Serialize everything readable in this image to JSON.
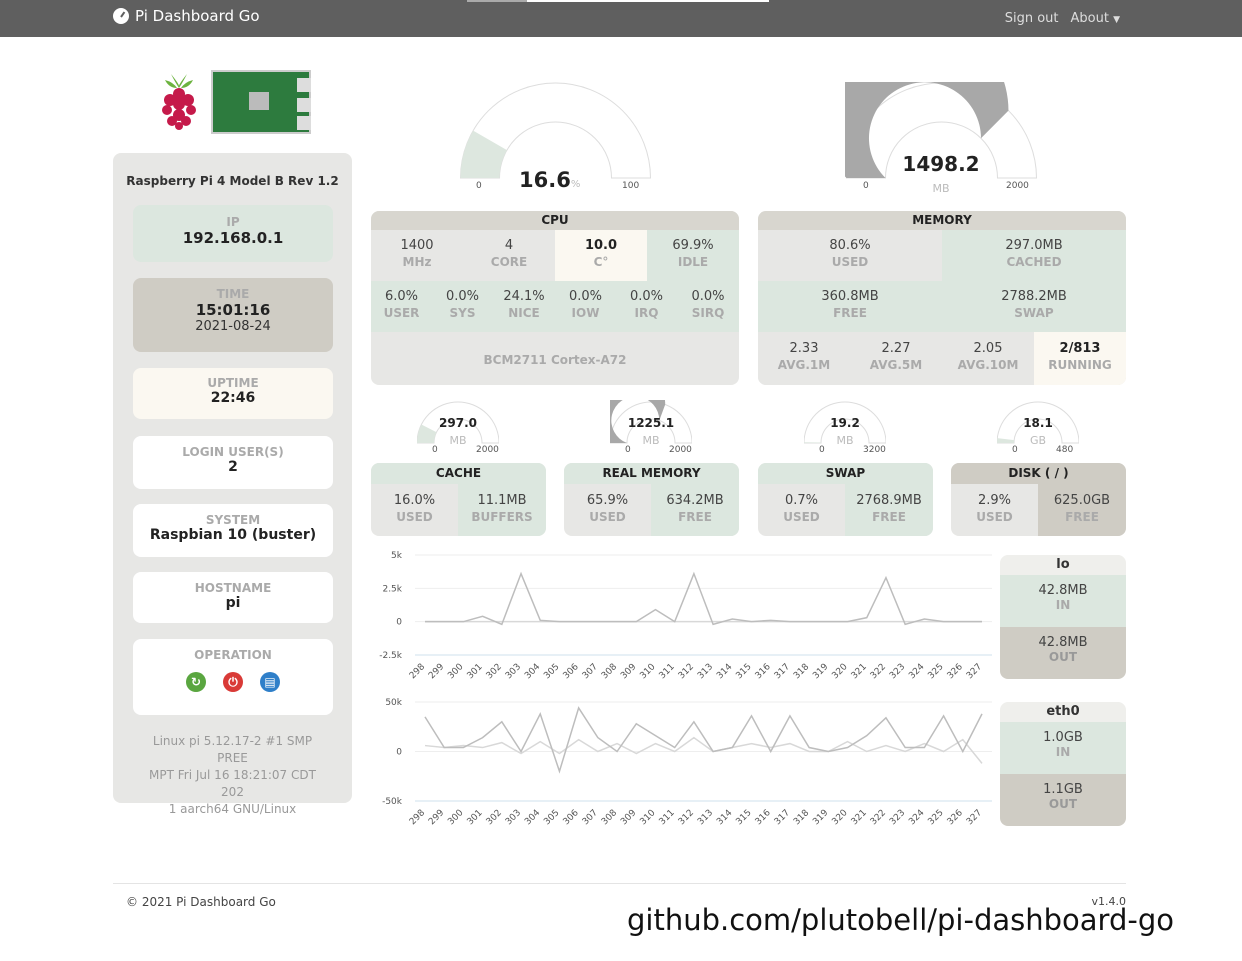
{
  "nav": {
    "brand": "Pi Dashboard Go",
    "sign_out": "Sign out",
    "about": "About"
  },
  "colors": {
    "green": "#dce7df",
    "tan": "#cfccc4",
    "cream": "#fbf8f1",
    "white": "#ffffff",
    "header": "#d8d6cf",
    "gray_panel": "#e7e7e5",
    "gauge_fill": "#a8a8a8",
    "gauge_green": "#dde7df"
  },
  "sidebar": {
    "model": "Raspberry Pi 4 Model B Rev 1.2",
    "ip": {
      "label": "IP",
      "value": "192.168.0.1"
    },
    "time": {
      "label": "TIME",
      "value": "15:01:16",
      "date": "2021-08-24"
    },
    "uptime": {
      "label": "UPTIME",
      "value": "22:46"
    },
    "login": {
      "label": "LOGIN USER(S)",
      "value": "2"
    },
    "system": {
      "label": "SYSTEM",
      "value": "Raspbian 10 (buster)"
    },
    "hostname": {
      "label": "HOSTNAME",
      "value": "pi"
    },
    "operation": {
      "label": "OPERATION",
      "icons": [
        "reboot-icon",
        "power-icon",
        "trash-icon"
      ]
    },
    "sysinfo": [
      "Linux pi 5.12.17-2 #1 SMP PREE",
      "MPT Fri Jul 16 18:21:07 CDT 202",
      "1 aarch64 GNU/Linux"
    ]
  },
  "cpu_gauge": {
    "value": "16.6",
    "unit": "%",
    "min": "0",
    "max": "100",
    "level": 0.166
  },
  "mem_gauge": {
    "value": "1498.2",
    "unit": "MB",
    "min": "0",
    "max": "2000",
    "level": 0.749
  },
  "cpu": {
    "title": "CPU",
    "row1": [
      {
        "v": "1400",
        "l": "MHz"
      },
      {
        "v": "4",
        "l": "CORE"
      },
      {
        "v": "10.0",
        "l": "C°"
      },
      {
        "v": "69.9%",
        "l": "IDLE"
      }
    ],
    "row2": [
      {
        "v": "6.0%",
        "l": "USER"
      },
      {
        "v": "0.0%",
        "l": "SYS"
      },
      {
        "v": "24.1%",
        "l": "NICE"
      },
      {
        "v": "0.0%",
        "l": "IOW"
      },
      {
        "v": "0.0%",
        "l": "IRQ"
      },
      {
        "v": "0.0%",
        "l": "SIRQ"
      }
    ],
    "model": "BCM2711 Cortex-A72"
  },
  "memory": {
    "title": "MEMORY",
    "row1": [
      {
        "v": "80.6%",
        "l": "USED"
      },
      {
        "v": "297.0MB",
        "l": "CACHED"
      }
    ],
    "row2": [
      {
        "v": "360.8MB",
        "l": "FREE"
      },
      {
        "v": "2788.2MB",
        "l": "SWAP"
      }
    ],
    "row3": [
      {
        "v": "2.33",
        "l": "AVG.1M"
      },
      {
        "v": "2.27",
        "l": "AVG.5M"
      },
      {
        "v": "2.05",
        "l": "AVG.10M"
      },
      {
        "v": "2/813",
        "l": "RUNNING"
      }
    ]
  },
  "small_gauges": [
    {
      "value": "297.0",
      "unit": "MB",
      "min": "0",
      "max": "2000",
      "level": 0.1485,
      "fill": "#dde7df",
      "title": "CACHE",
      "a": {
        "v": "16.0%",
        "l": "USED"
      },
      "b": {
        "v": "11.1MB",
        "l": "BUFFERS"
      }
    },
    {
      "value": "1225.1",
      "unit": "MB",
      "min": "0",
      "max": "2000",
      "level": 0.6126,
      "fill": "#a8a8a8",
      "title": "REAL MEMORY",
      "a": {
        "v": "65.9%",
        "l": "USED"
      },
      "b": {
        "v": "634.2MB",
        "l": "FREE"
      }
    },
    {
      "value": "19.2",
      "unit": "MB",
      "min": "0",
      "max": "3200",
      "level": 0.006,
      "fill": "#dde7df",
      "title": "SWAP",
      "a": {
        "v": "0.7%",
        "l": "USED"
      },
      "b": {
        "v": "2768.9MB",
        "l": "FREE"
      }
    },
    {
      "value": "18.1",
      "unit": "GB",
      "min": "0",
      "max": "480",
      "level": 0.0377,
      "fill": "#dde7df",
      "title": "DISK ( / )",
      "a": {
        "v": "2.9%",
        "l": "USED"
      },
      "b": {
        "v": "625.0GB",
        "l": "FREE"
      }
    }
  ],
  "net": [
    {
      "name": "lo",
      "in": "42.8MB",
      "in_l": "IN",
      "out": "42.8MB",
      "out_l": "OUT"
    },
    {
      "name": "eth0",
      "in": "1.0GB",
      "in_l": "IN",
      "out": "1.1GB",
      "out_l": "OUT"
    }
  ],
  "chart_data": [
    {
      "type": "line",
      "x": [
        "298",
        "299",
        "300",
        "301",
        "302",
        "303",
        "304",
        "305",
        "306",
        "307",
        "308",
        "309",
        "310",
        "311",
        "312",
        "313",
        "314",
        "315",
        "316",
        "317",
        "318",
        "319",
        "320",
        "321",
        "322",
        "323",
        "324",
        "325",
        "326",
        "327"
      ],
      "yticks": [
        "5k",
        "2.5k",
        "0",
        "-2.5k"
      ],
      "ylim": [
        -2500,
        5000
      ],
      "series": [
        {
          "values": [
            0,
            0,
            0,
            400,
            -200,
            3600,
            100,
            0,
            0,
            0,
            0,
            0,
            900,
            0,
            3600,
            -200,
            200,
            0,
            100,
            0,
            0,
            0,
            0,
            300,
            3300,
            -200,
            200,
            0,
            0,
            0
          ],
          "color": "#bdbdbd"
        },
        {
          "values": [
            0,
            0,
            0,
            0,
            0,
            0,
            0,
            0,
            0,
            0,
            0,
            0,
            0,
            0,
            0,
            0,
            0,
            0,
            0,
            0,
            0,
            0,
            0,
            0,
            0,
            0,
            0,
            0,
            0,
            0
          ],
          "color": "#d8d8d8"
        }
      ]
    },
    {
      "type": "line",
      "x": [
        "298",
        "299",
        "300",
        "301",
        "302",
        "303",
        "304",
        "305",
        "306",
        "307",
        "308",
        "309",
        "310",
        "311",
        "312",
        "313",
        "314",
        "315",
        "316",
        "317",
        "318",
        "319",
        "320",
        "321",
        "322",
        "323",
        "324",
        "325",
        "326",
        "327"
      ],
      "yticks": [
        "50k",
        "0",
        "-50k"
      ],
      "ylim": [
        -50000,
        50000
      ],
      "series": [
        {
          "values": [
            35000,
            4000,
            4000,
            14000,
            30000,
            0,
            38000,
            -20000,
            44000,
            14000,
            0,
            28000,
            16000,
            4000,
            30000,
            0,
            4000,
            36000,
            0,
            36000,
            4000,
            0,
            4000,
            16000,
            34000,
            4000,
            4000,
            36000,
            0,
            38000
          ],
          "color": "#bdbdbd"
        },
        {
          "values": [
            6000,
            4000,
            6000,
            4000,
            9000,
            -2000,
            10000,
            -2000,
            12000,
            0,
            8000,
            -2000,
            8000,
            0,
            14000,
            0,
            4000,
            8000,
            4000,
            8000,
            0,
            0,
            10000,
            0,
            6000,
            0,
            8000,
            0,
            12000,
            -12000
          ],
          "color": "#d8d8d8"
        }
      ]
    }
  ],
  "footer": {
    "copyright": "© 2021 Pi Dashboard Go",
    "version": "v1.4.0"
  },
  "watermark": "github.com/plutobell/pi-dashboard-go"
}
